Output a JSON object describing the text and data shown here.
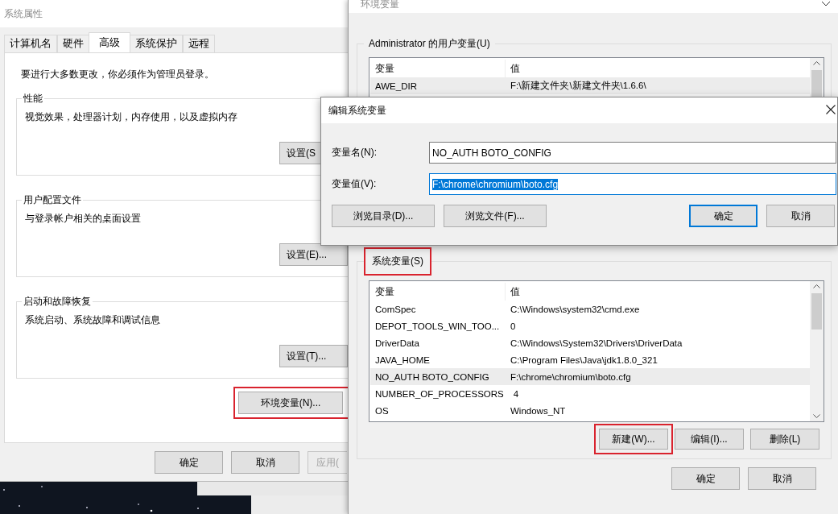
{
  "system_properties": {
    "title": "系统属性",
    "tabs": [
      {
        "label": "计算机名",
        "selected": false
      },
      {
        "label": "硬件",
        "selected": false
      },
      {
        "label": "高级",
        "selected": true
      },
      {
        "label": "系统保护",
        "selected": false
      },
      {
        "label": "远程",
        "selected": false
      }
    ],
    "notice": "要进行大多数更改，你必须作为管理员登录。",
    "groups": [
      {
        "title": "性能",
        "description": "视觉效果，处理器计划，内存使用，以及虚拟内存",
        "button": "设置(S"
      },
      {
        "title": "用户配置文件",
        "description": "与登录帐户相关的桌面设置",
        "button": "设置(E)..."
      },
      {
        "title": "启动和故障恢复",
        "description": "系统启动、系统故障和调试信息",
        "button": "设置(T)..."
      }
    ],
    "env_button": {
      "label": "环境变量(N)...",
      "highlighted": true
    },
    "buttons": [
      {
        "label": "确定",
        "disabled": false
      },
      {
        "label": "取消",
        "disabled": false
      },
      {
        "label": "应用(",
        "disabled": true
      }
    ]
  },
  "environment_variables": {
    "title": "环境变量",
    "user_group": {
      "title": "Administrator 的用户变量(U)",
      "highlighted": false,
      "columns": [
        "变量",
        "值"
      ],
      "rows": [
        {
          "name": "AWE_DIR",
          "value": "F:\\新建文件夹\\新建文件夹\\1.6.6\\",
          "selected": true
        }
      ]
    },
    "system_group": {
      "title": "系统变量(S)",
      "highlighted": true,
      "columns": [
        "变量",
        "值"
      ],
      "rows": [
        {
          "name": "ComSpec",
          "value": "C:\\Windows\\system32\\cmd.exe",
          "selected": false
        },
        {
          "name": "DEPOT_TOOLS_WIN_TOO...",
          "value": "0",
          "selected": false
        },
        {
          "name": "DriverData",
          "value": "C:\\Windows\\System32\\Drivers\\DriverData",
          "selected": false
        },
        {
          "name": "JAVA_HOME",
          "value": "C:\\Program Files\\Java\\jdk1.8.0_321",
          "selected": false
        },
        {
          "name": "NO_AUTH BOTO_CONFIG",
          "value": "F:\\chrome\\chromium\\boto.cfg",
          "selected": true
        },
        {
          "name": "NUMBER_OF_PROCESSORS",
          "value": "4",
          "selected": false
        },
        {
          "name": "OS",
          "value": "Windows_NT",
          "selected": false
        }
      ]
    },
    "system_buttons": [
      {
        "label": "新建(W)...",
        "highlighted": true
      },
      {
        "label": "编辑(I)...",
        "highlighted": false
      },
      {
        "label": "删除(L)",
        "highlighted": false
      }
    ],
    "buttons": [
      {
        "label": "确定"
      },
      {
        "label": "取消"
      }
    ]
  },
  "edit_dialog": {
    "title": "编辑系统变量",
    "fields": [
      {
        "label": "变量名(N):",
        "value": "NO_AUTH BOTO_CONFIG",
        "selected": false
      },
      {
        "label": "变量值(V):",
        "value": "F:\\chrome\\chromium\\boto.cfg",
        "selected": true
      }
    ],
    "buttons": [
      {
        "label": "浏览目录(D)...",
        "default": false
      },
      {
        "label": "浏览文件(F)...",
        "default": false
      },
      {
        "label": "确定",
        "default": true
      },
      {
        "label": "取消",
        "default": false
      }
    ]
  }
}
